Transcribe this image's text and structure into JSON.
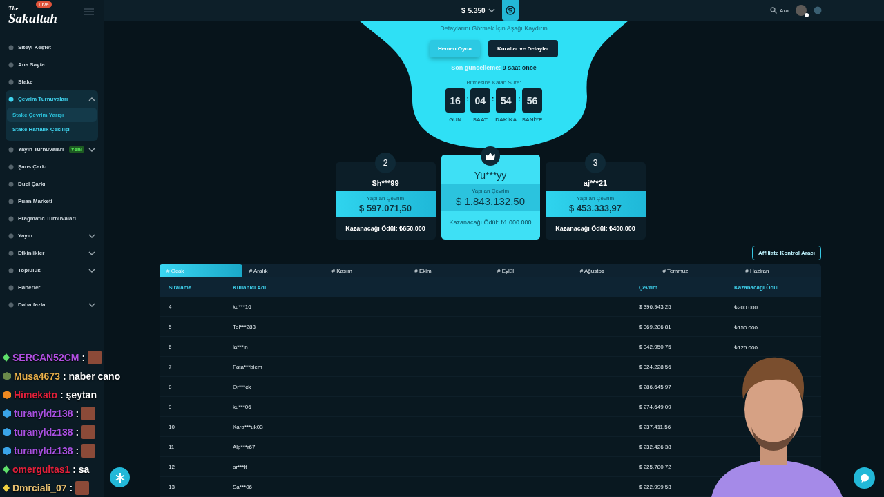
{
  "sidebar": {
    "logo_small": "The",
    "logo": "Sakultah",
    "live_badge": "Live",
    "items": [
      {
        "label": "Siteyi Keşfet"
      },
      {
        "label": "Ana Sayfa"
      },
      {
        "label": "Stake"
      },
      {
        "label": "Çevrim Turnuvaları",
        "expanded": true,
        "has_children": true,
        "children": [
          {
            "label": "Stake Çevrim Yarışı",
            "selected": true
          },
          {
            "label": "Stake Haftalık Çekilişi",
            "selected": false
          }
        ]
      },
      {
        "label": "Yayın Turnuvaları",
        "badge": "Yeni",
        "expanded": false,
        "has_children": true
      },
      {
        "label": "Şans Çarkı"
      },
      {
        "label": "Duel Çarkı"
      },
      {
        "label": "Puan Marketi"
      },
      {
        "label": "Pragmatic Turnuvaları"
      },
      {
        "label": "Yayın",
        "expanded": false,
        "has_children": true
      },
      {
        "label": "Etkinlikler",
        "expanded": false,
        "has_children": true
      },
      {
        "label": "Topluluk",
        "expanded": false,
        "has_children": true
      },
      {
        "label": "Haberler"
      },
      {
        "label": "Daha fazla",
        "expanded": false,
        "has_children": true
      }
    ]
  },
  "topbar": {
    "currency": "$",
    "balance": "5.350",
    "search": "Ara"
  },
  "hero": {
    "subtitle": "Detaylarını Görmek İçin Aşağı Kaydırın",
    "buttons": [
      "Hemen Oyna",
      "Kurallar ve Detaylar"
    ],
    "update_label": "Son güncelleme:",
    "update_value": "9 saat önce",
    "countdown_label": "Bitmesine Kalan Süre:",
    "countdown": [
      {
        "value": "16",
        "unit": "GÜN"
      },
      {
        "separator": ":",
        "value": "04",
        "unit": "SAAT"
      },
      {
        "separator": ":",
        "value": "54",
        "unit": "DAKİKA"
      },
      {
        "separator": ":",
        "value": "56",
        "unit": "SANİYE"
      }
    ]
  },
  "podium": [
    {
      "rank": "2",
      "user": "Sh***99",
      "wager_label": "Yapılan Çevrim",
      "wager": "$ 597.071,50",
      "prize": "Kazanacağı Ödül: ₺650.000",
      "first": false
    },
    {
      "user": "Yu***yy",
      "wager_label": "Yapılan Çevrim",
      "wager": "$ 1.843.132,50",
      "prize": "Kazanacağı Ödül: ₺1.000.000",
      "first": true
    },
    {
      "rank": "3",
      "user": "aj***21",
      "wager_label": "Yapılan Çevrim",
      "wager": "$ 453.333,97",
      "prize": "Kazanacağı Ödül: ₺400.000",
      "first": false
    }
  ],
  "affiliate_button": "Affiliate Kontrol Aracı",
  "months": [
    {
      "label": "# Ocak",
      "selected": true
    },
    {
      "label": "# Aralık",
      "selected": false
    },
    {
      "label": "# Kasım",
      "selected": false
    },
    {
      "label": "# Ekim",
      "selected": false
    },
    {
      "label": "# Eylül",
      "selected": false
    },
    {
      "label": "# Ağustos",
      "selected": false
    },
    {
      "label": "# Temmuz",
      "selected": false
    },
    {
      "label": "# Haziran",
      "selected": false
    }
  ],
  "table": {
    "columns": [
      "Sıralama",
      "Kullanıcı Adı",
      "Çevrim",
      "Kazanacağı Ödül"
    ],
    "rows": [
      [
        "4",
        "ku***16",
        "$ 396.943,25",
        "₺200.000"
      ],
      [
        "5",
        "Tol***283",
        "$ 369.286,81",
        "₺150.000"
      ],
      [
        "6",
        "la***in",
        "$ 342.950,75",
        "₺125.000"
      ],
      [
        "7",
        "Fata***biem",
        "$ 324.228,56"
      ],
      [
        "8",
        "Or***ck",
        "$ 286.645,97"
      ],
      [
        "9",
        "ku***06",
        "$ 274.649,09"
      ],
      [
        "10",
        "Kara***uk03",
        "$ 237.411,56"
      ],
      [
        "11",
        "Alp***r67",
        "$ 232.426,38"
      ],
      [
        "12",
        "ar***lt",
        "$ 225.780,72"
      ],
      [
        "13",
        "Sa***06",
        "$ 222.999,53"
      ]
    ]
  },
  "chat": [
    {
      "user": "SERCAN52CM",
      "color": "#b04fe0",
      "kind": "gem",
      "message": ":",
      "emote": true
    },
    {
      "user": "Musa4673",
      "color": "#e8b04a",
      "kind": "sub",
      "message": ": naber cano"
    },
    {
      "user": "Himekato",
      "color": "#e0203a",
      "kind": "cube",
      "message": ": şeytan"
    },
    {
      "user": "turanyldz138",
      "color": "#a850e0",
      "kind": "bluecube",
      "message": ":",
      "emote": true
    },
    {
      "user": "turanyldz138",
      "color": "#a850e0",
      "kind": "bluecube",
      "message": ":",
      "emote": true
    },
    {
      "user": "turanyldz138",
      "color": "#a850e0",
      "kind": "bluecube",
      "message": ":",
      "emote": true
    },
    {
      "user": "omergultas1",
      "color": "#e0203a",
      "kind": "gem",
      "message": ": sa"
    },
    {
      "user": "Dmrciali_07",
      "color": "#e8c070",
      "kind": "gold",
      "message": ":",
      "emote": true
    }
  ]
}
